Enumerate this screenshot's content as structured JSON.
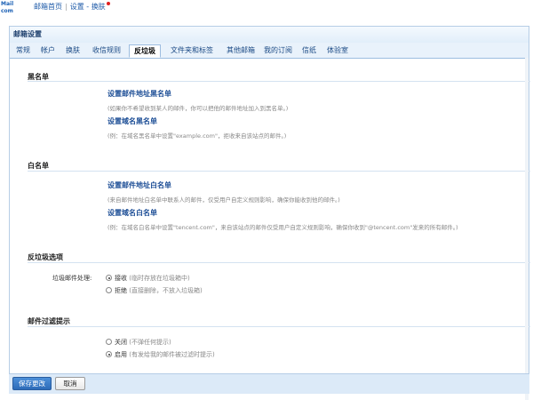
{
  "logo": {
    "line1": "Mail",
    "line2": "com"
  },
  "breadcrumb": {
    "home": "邮箱首页",
    "sep": "|",
    "settings": "设置",
    "dash": "-",
    "current": "换肤"
  },
  "panel": {
    "title": "邮箱设置"
  },
  "tabs": [
    "常规",
    "帐户",
    "换肤",
    "收信规则",
    "反垃圾",
    "文件夹和标签",
    "其他邮箱",
    "我的订阅",
    "信纸",
    "体验室"
  ],
  "active_tab": "反垃圾",
  "blacklist": {
    "title": "黑名单",
    "addr_link": "设置邮件地址黑名单",
    "addr_note": "(如果你不希望收到某人的邮件，你可以把他的邮件地址加入到黑名单。)",
    "domain_link": "设置域名黑名单",
    "domain_note": "(例：在域名黑名单中设置\"example.com\"，拒收来自该站点的邮件。)"
  },
  "whitelist": {
    "title": "白名单",
    "addr_link": "设置邮件地址白名单",
    "addr_note": "(来自邮件地址白名单中联系人的邮件，仅受用户自定义规则影响，确保你能收到他的邮件。)",
    "domain_link": "设置域名白名单",
    "domain_note": "(例：在域名白名单中设置\"tencent.com\"，来自该站点的邮件仅受用户自定义规则影响，确保你收到\"@tencent.com\"发来的所有邮件。)"
  },
  "antispam": {
    "title": "反垃圾选项",
    "label": "垃圾邮件处理:",
    "options": [
      {
        "label": "接收",
        "desc": "(临时存放在垃圾箱中)",
        "selected": true
      },
      {
        "label": "拒绝",
        "desc": "(直接删除，不放入垃圾箱)",
        "selected": false
      }
    ]
  },
  "filter_hint": {
    "title": "邮件过滤提示",
    "options": [
      {
        "label": "关闭",
        "desc": "(不弹任何提示)",
        "selected": false
      },
      {
        "label": "启用",
        "desc": "(有发给我的邮件被过滤时提示)",
        "selected": true
      }
    ]
  },
  "footer": {
    "save": "保存更改",
    "cancel": "取消"
  },
  "colors": {
    "accent": "#2d6bb8",
    "link": "#1d4e96",
    "tab_bg": "#e9f2fb"
  }
}
